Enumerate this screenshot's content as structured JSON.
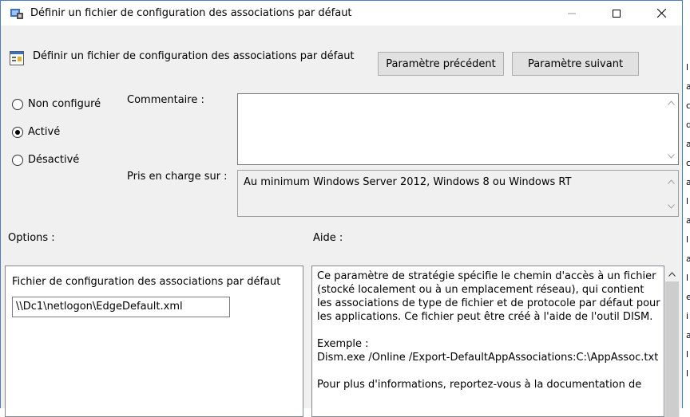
{
  "window": {
    "title": "Définir un fichier de configuration des associations par défaut",
    "header_title": "Définir un fichier de configuration des associations par défaut",
    "buttons": {
      "previous": "Paramètre précédent",
      "next": "Paramètre suivant"
    }
  },
  "state": {
    "options": [
      "Non configuré",
      "Activé",
      "Désactivé"
    ],
    "selected": "Activé"
  },
  "comment": {
    "label": "Commentaire :",
    "value": ""
  },
  "supported": {
    "label": "Pris en charge sur :",
    "value": "Au minimum Windows Server 2012, Windows 8 ou Windows RT"
  },
  "options_section": {
    "label": "Options :",
    "field_label": "Fichier de configuration des associations par défaut",
    "field_value": "\\\\Dc1\\netlogon\\EdgeDefault.xml"
  },
  "help_section": {
    "label": "Aide :",
    "paragraph1": "Ce paramètre de stratégie spécifie le chemin d'accès à un fichier (stocké localement ou à un emplacement réseau), qui contient les associations de type de fichier et de protocole par défaut pour les applications. Ce fichier peut être créé à l'aide de l'outil DISM.",
    "example_label": "Exemple :",
    "example_value": "Dism.exe /Online /Export-DefaultAppAssociations:C:\\AppAssoc.txt",
    "paragraph3": "Pour plus d'informations, reportez-vous à la documentation de"
  },
  "background_letters": [
    "l",
    "a",
    "c",
    "d",
    "a",
    "c",
    "a",
    "l",
    "a",
    "l",
    "a",
    "l",
    "e",
    "i",
    "a",
    "l",
    "l"
  ],
  "colors": {
    "window_border": "#4a7fc8",
    "dialog_bg": "#f0f0f0",
    "button_bg": "#e1e1e1"
  },
  "icons": [
    "policy-icon",
    "settings-icon",
    "minimize-icon",
    "maximize-icon",
    "close-icon",
    "chevron-up-icon",
    "chevron-down-icon"
  ]
}
